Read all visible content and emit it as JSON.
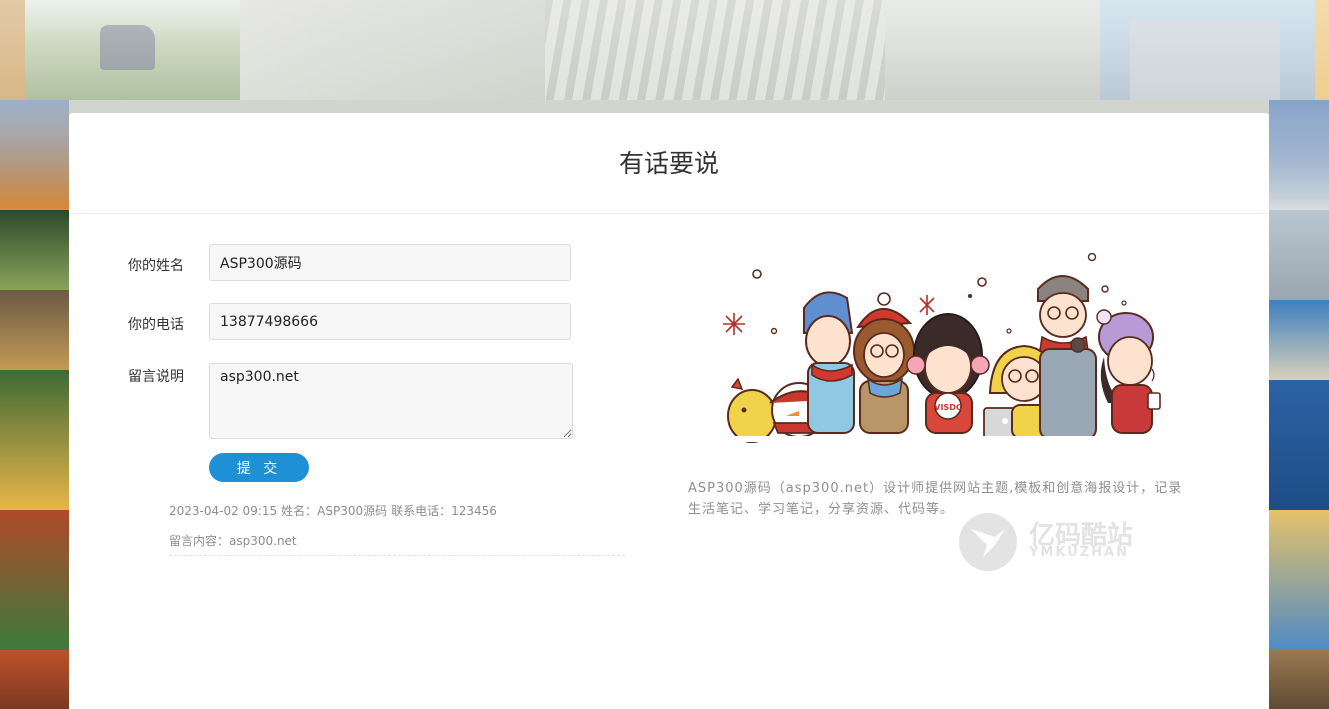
{
  "page": {
    "title": "有话要说"
  },
  "form": {
    "name_label": "你的姓名",
    "name_value": "ASP300源码",
    "phone_label": "你的电话",
    "phone_value": "13877498666",
    "message_label": "留言说明",
    "message_value": "asp300.net",
    "submit_label": "提 交"
  },
  "messages": [
    {
      "datetime": "2023-04-02 09:15",
      "name_text": "姓名：ASP300源码",
      "phone_text": "联系电话：123456",
      "content_text": "留言内容：asp300.net"
    }
  ],
  "description": "ASP300源码（asp300.net）设计师提供网站主题,模板和创意海报设计，记录生活笔记、学习笔记，分享资源、代码等。",
  "illustration": {
    "badge_text": "VISDC"
  },
  "watermark": {
    "text": "亿码酷站",
    "sub": "YMKUZHAN"
  },
  "colors": {
    "accent": "#1e90d6",
    "card_bg": "#ffffff",
    "input_bg": "#f6f6f6"
  }
}
